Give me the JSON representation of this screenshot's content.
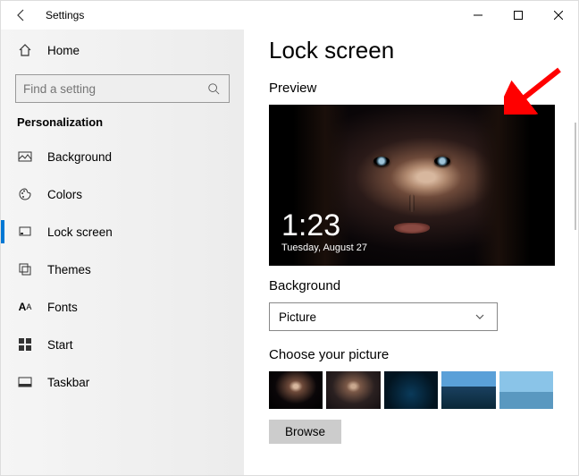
{
  "titlebar": {
    "title": "Settings"
  },
  "sidebar": {
    "home_label": "Home",
    "search_placeholder": "Find a setting",
    "category": "Personalization",
    "items": [
      {
        "label": "Background"
      },
      {
        "label": "Colors"
      },
      {
        "label": "Lock screen"
      },
      {
        "label": "Themes"
      },
      {
        "label": "Fonts"
      },
      {
        "label": "Start"
      },
      {
        "label": "Taskbar"
      }
    ]
  },
  "main": {
    "heading": "Lock screen",
    "preview_label": "Preview",
    "clock_time": "1:23",
    "clock_date": "Tuesday, August 27",
    "background_label": "Background",
    "background_value": "Picture",
    "choose_label": "Choose your picture",
    "browse_label": "Browse"
  },
  "annotation": {
    "arrow_color": "#ff0000"
  }
}
